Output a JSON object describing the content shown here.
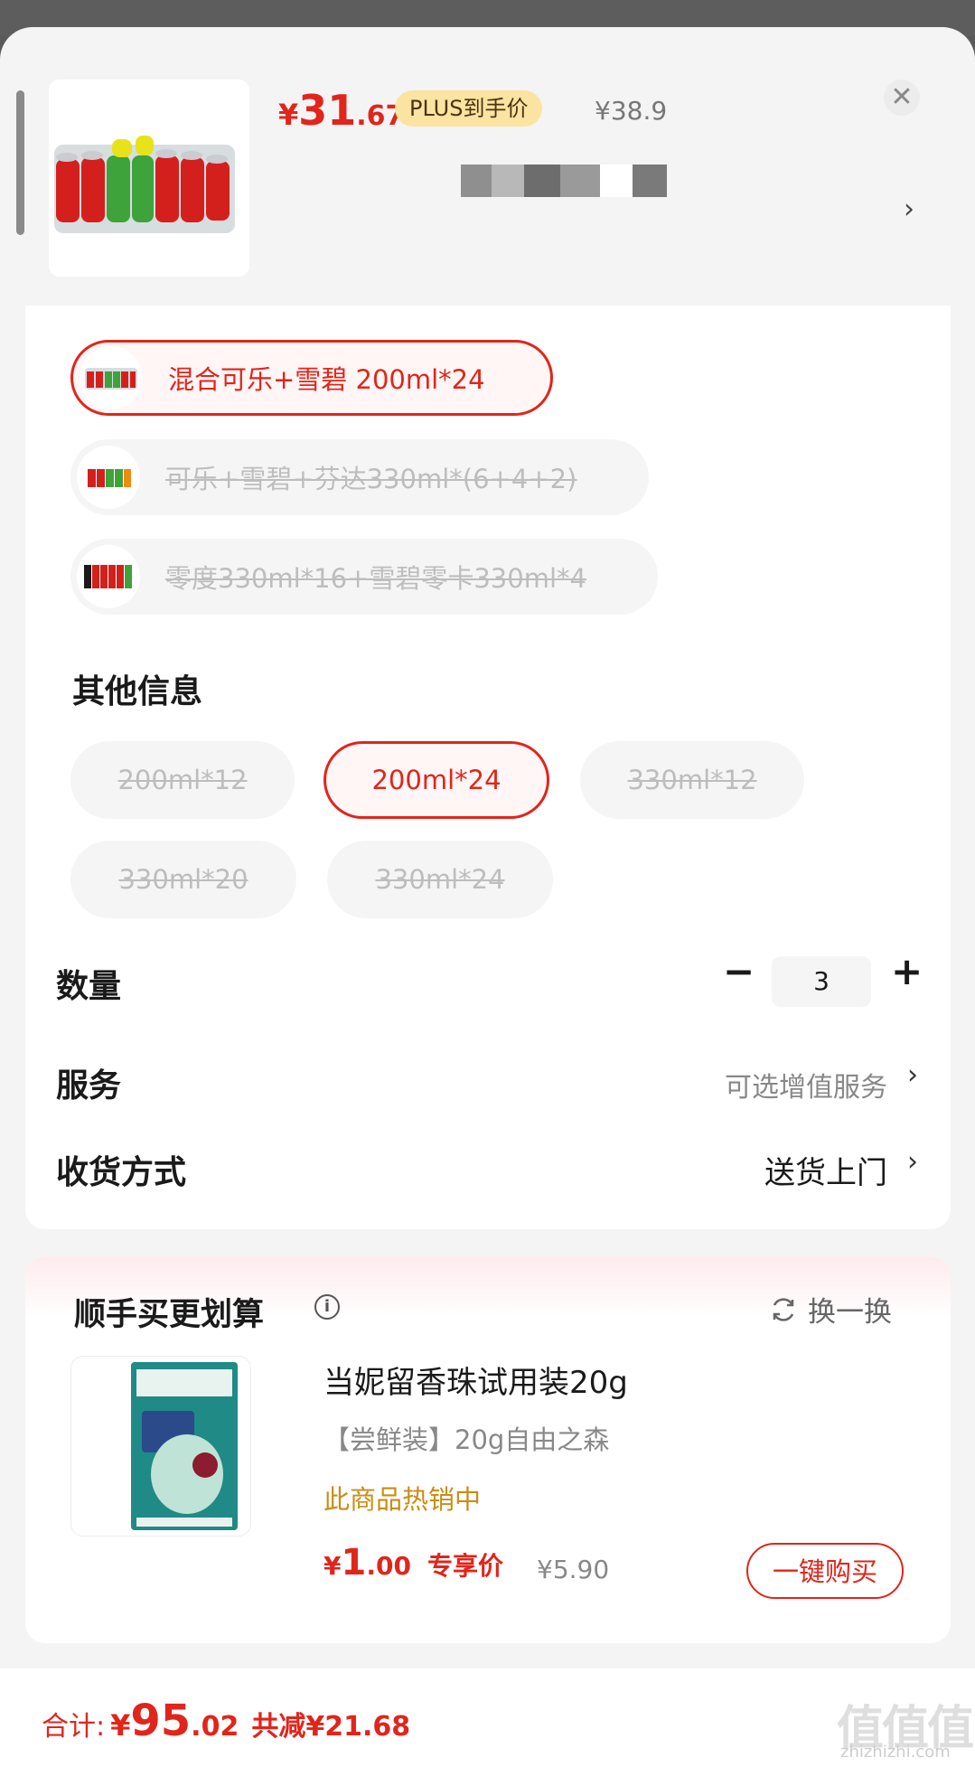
{
  "header": {
    "price_currency": "¥",
    "price_int": "31",
    "price_dec": ".67",
    "plus_tag": "PLUS到手价",
    "original_price": "¥38.9",
    "close_glyph": "✕",
    "chevron": "›"
  },
  "flavor_options": [
    {
      "label": "混合可乐+雪碧 200ml*24",
      "selected": true
    },
    {
      "label": "可乐+雪碧+芬达330ml*(6+4+2)",
      "selected": false
    },
    {
      "label": "零度330ml*16+雪碧零卡330ml*4",
      "selected": false
    }
  ],
  "other_info": {
    "title": "其他信息",
    "chips": [
      {
        "label": "200ml*12",
        "selected": false
      },
      {
        "label": "200ml*24",
        "selected": true
      },
      {
        "label": "330ml*12",
        "selected": false
      },
      {
        "label": "330ml*20",
        "selected": false
      },
      {
        "label": "330ml*24",
        "selected": false
      }
    ]
  },
  "quantity": {
    "label": "数量",
    "minus": "−",
    "value": "3",
    "plus": "+"
  },
  "service": {
    "label": "服务",
    "value": "可选增值服务",
    "chevron": "›"
  },
  "delivery": {
    "label": "收货方式",
    "value": "送货上门",
    "chevron": "›"
  },
  "recommend": {
    "title": "顺手买更划算",
    "info_glyph": "i",
    "swap_label": "换一换",
    "item": {
      "name": "当妮留香珠试用装20g",
      "subtitle": "【尝鲜装】20g自由之森",
      "hot": "此商品热销中",
      "price_currency": "¥",
      "price_int": "1",
      "price_dec": ".00",
      "price_tag": "专享价",
      "original_price": "¥5.90",
      "buy_label": "一键购买"
    }
  },
  "bottom": {
    "total_label": "合计:",
    "total_currency": "¥",
    "total_int": "95",
    "total_dec": ".02",
    "discount": "共减¥21.68"
  },
  "watermark": {
    "text": "值值值",
    "sub": "zhizhizhi.com"
  },
  "colors": {
    "accent": "#e1251b",
    "plus_tag_bg": "#fbe3a1",
    "hot": "#c98d17",
    "buy_yellow": "#ffc31c"
  }
}
